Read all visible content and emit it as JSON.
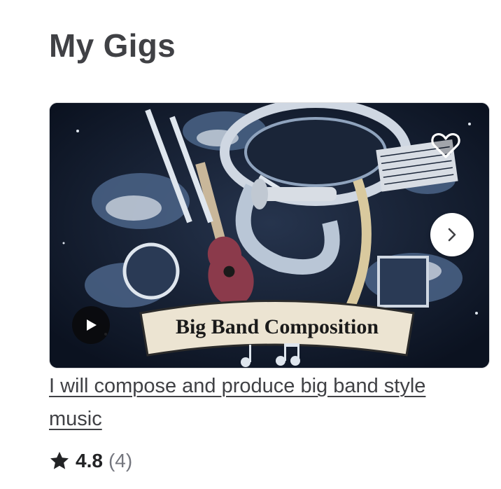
{
  "section": {
    "title": "My Gigs"
  },
  "gig": {
    "image_caption": "Big Band Composition",
    "title": "I will compose and produce big band style music",
    "rating": {
      "score": "4.8",
      "count": "(4)"
    },
    "icons": {
      "favorite": "heart-icon",
      "next": "chevron-right-icon",
      "play": "play-icon",
      "rating": "star-icon"
    }
  },
  "colors": {
    "text": "#404145",
    "muted": "#74767e",
    "thumb_bg": "#0f1726"
  }
}
